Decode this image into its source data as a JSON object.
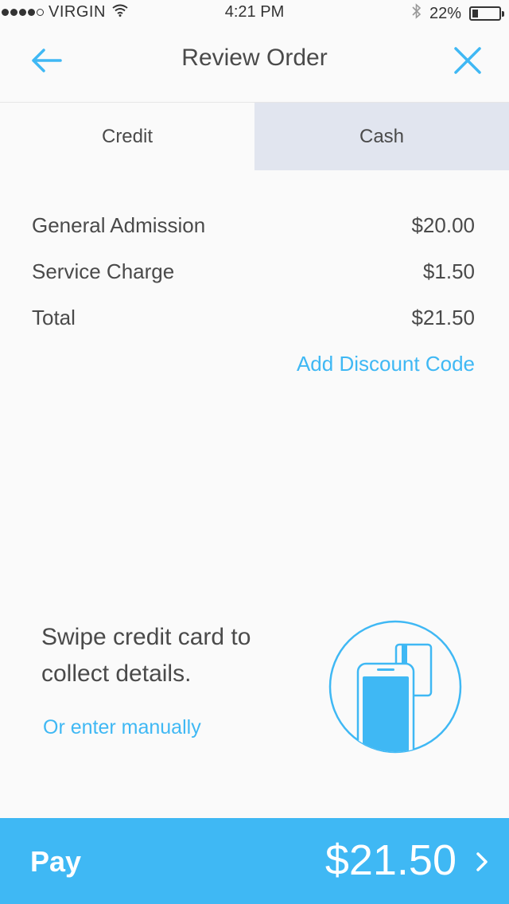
{
  "status_bar": {
    "carrier": "VIRGIN",
    "time": "4:21 PM",
    "battery": "22%",
    "battery_level": 0.22,
    "signal_bars_filled": 4,
    "signal_bars_total": 5
  },
  "nav": {
    "title": "Review Order",
    "back_icon": "arrow-left-icon",
    "close_icon": "close-icon"
  },
  "tabs": [
    {
      "label": "Credit",
      "active": true
    },
    {
      "label": "Cash",
      "active": false
    }
  ],
  "line_items": [
    {
      "label": "General Admission",
      "amount": "$20.00"
    },
    {
      "label": "Service Charge",
      "amount": "$1.50"
    },
    {
      "label": "Total",
      "amount": "$21.50"
    }
  ],
  "discount_link": "Add Discount Code",
  "swipe": {
    "instruction": "Swipe credit card to collect details.",
    "manual_link": "Or enter manually",
    "illustration_icon": "phone-card-swipe-icon"
  },
  "pay_bar": {
    "label": "Pay",
    "amount": "$21.50",
    "chevron_icon": "chevron-right-icon"
  },
  "colors": {
    "accent": "#3fb8f4",
    "inactive_tab": "#e1e5ef",
    "text": "#4a4a4a",
    "background": "#fafafa"
  }
}
